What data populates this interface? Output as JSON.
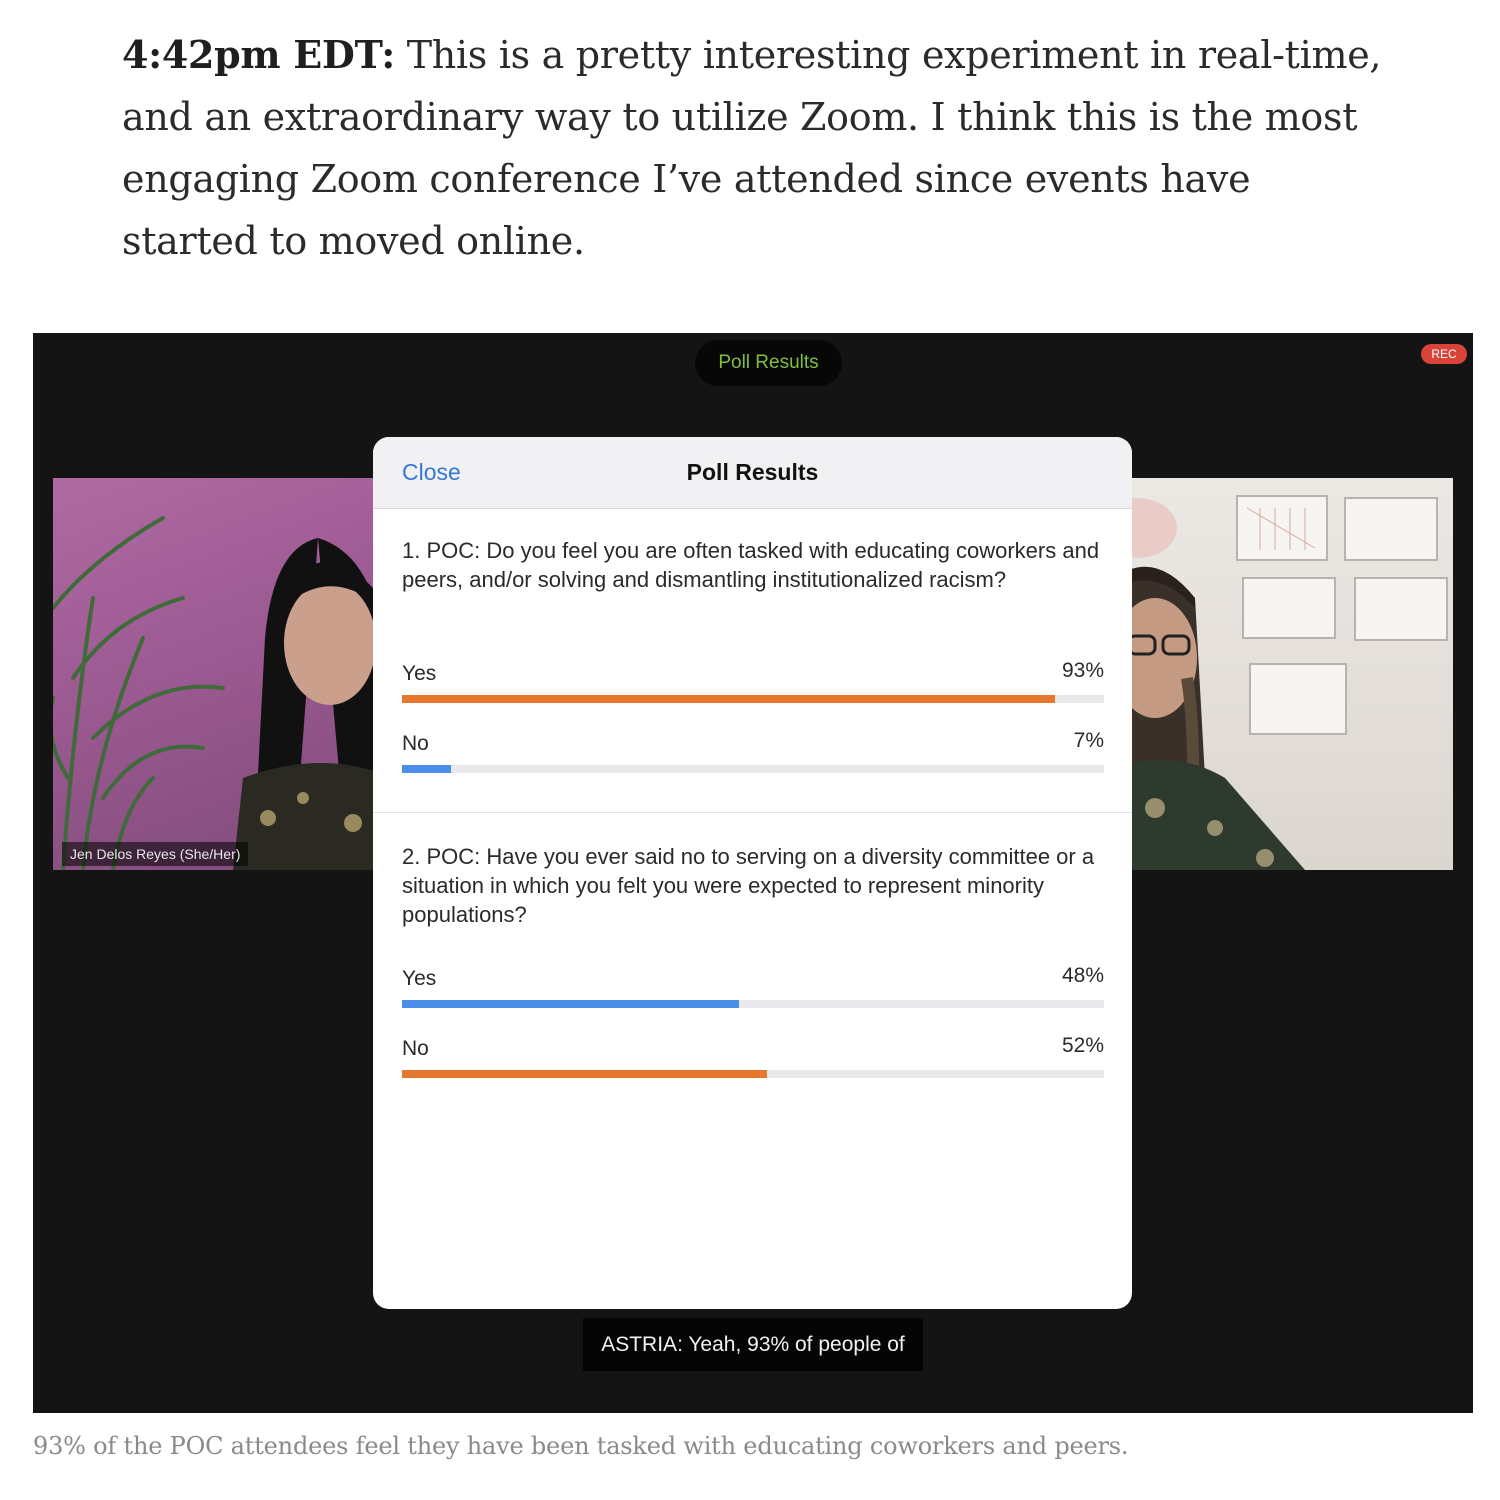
{
  "article": {
    "timestamp": "4:42pm EDT:",
    "body": " This is a pretty interesting experiment in real-time, and an extraordinary way to utilize Zoom. I think this is the most engaging Zoom conference I’ve attended since events have started to moved online."
  },
  "zoom": {
    "pill_title": "Poll Results",
    "rec_badge": "REC",
    "participant_left_name": "Jen Delos Reyes (She/Her)",
    "live_caption": "ASTRIA: Yeah, 93% of people of"
  },
  "poll": {
    "close_label": "Close",
    "title": "Poll Results",
    "questions": [
      {
        "text": "1. POC: Do you feel you are often tasked with educating coworkers and peers, and/or solving and dismantling institutionalized racism?",
        "options": [
          {
            "label": "Yes",
            "pct_text": "93%",
            "value": 0.93,
            "color": "#e8772e"
          },
          {
            "label": "No",
            "pct_text": "7%",
            "value": 0.07,
            "color": "#4a8fe7"
          }
        ]
      },
      {
        "text": "2. POC: Have you ever said no to serving on a diversity committee or a situation in which you felt you were expected to represent minority populations?",
        "options": [
          {
            "label": "Yes",
            "pct_text": "48%",
            "value": 0.48,
            "color": "#4a8fe7"
          },
          {
            "label": "No",
            "pct_text": "52%",
            "value": 0.52,
            "color": "#e8772e"
          }
        ]
      }
    ]
  },
  "figure_caption": "93% of the POC attendees feel they have been tasked with educating coworkers and peers."
}
